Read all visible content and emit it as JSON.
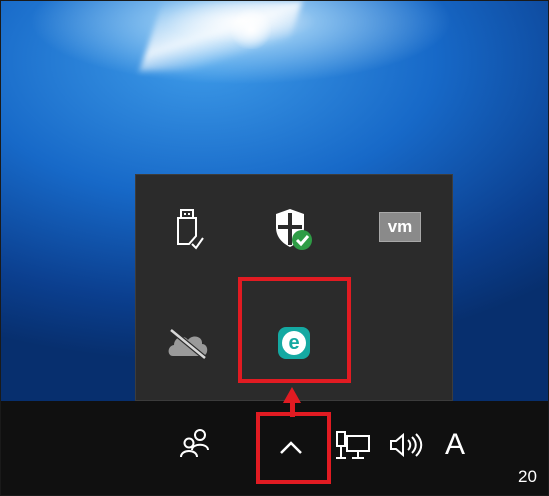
{
  "desktop": {
    "wallpaper": "windows-10-hero"
  },
  "tray_overflow": {
    "icons": [
      {
        "name": "usb-safely-remove-icon"
      },
      {
        "name": "windows-security-icon"
      },
      {
        "name": "vmware-icon",
        "label": "vm"
      },
      {
        "name": "onedrive-offline-icon"
      },
      {
        "name": "eset-icon",
        "label": "e"
      }
    ]
  },
  "taskbar": {
    "people_icon": "people-icon",
    "show_hidden_icon": "chevron-up-icon",
    "network_icon": "network-icon",
    "volume_icon": "volume-icon",
    "ime_indicator": "A",
    "clock_text": "20"
  },
  "colors": {
    "highlight": "#e11b22",
    "taskbar": "#101010",
    "tray_popup": "#2b2b2b",
    "eset_teal": "#14a9a2",
    "security_green": "#2e9c45",
    "vm_gray": "#8a8a8a"
  }
}
